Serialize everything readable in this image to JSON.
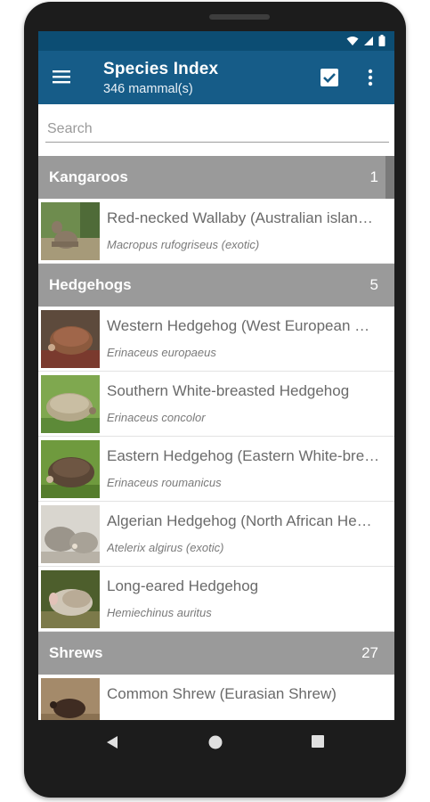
{
  "app": {
    "title": "Species Index",
    "subtitle": "346 mammal(s)",
    "menu_icon": "hamburger-menu-icon",
    "select_icon": "checkbox-icon",
    "more_icon": "more-vert-icon"
  },
  "colors": {
    "status_bar": "#0c4d73",
    "app_bar": "#165c88",
    "section_header": "#9a9a9a"
  },
  "search": {
    "placeholder": "Search"
  },
  "sections": [
    {
      "name": "Kangaroos",
      "count": "1",
      "items": [
        {
          "title": "Red-necked Wallaby (Australian islan…",
          "scientific": "Macropus rufogriseus (exotic)",
          "image": "wallaby-photo"
        }
      ]
    },
    {
      "name": "Hedgehogs",
      "count": "5",
      "items": [
        {
          "title": "Western Hedgehog (West European …",
          "scientific": "Erinaceus europaeus",
          "image": "hedgehog-photo"
        },
        {
          "title": "Southern White-breasted Hedgehog",
          "scientific": "Erinaceus concolor",
          "image": "hedgehog-photo"
        },
        {
          "title": "Eastern Hedgehog (Eastern White-bre…",
          "scientific": "Erinaceus roumanicus",
          "image": "hedgehog-photo"
        },
        {
          "title": "Algerian Hedgehog (North African He…",
          "scientific": "Atelerix algirus (exotic)",
          "image": "hedgehog-photo"
        },
        {
          "title": "Long-eared Hedgehog",
          "scientific": "Hemiechinus  auritus",
          "image": "hedgehog-photo"
        }
      ]
    },
    {
      "name": "Shrews",
      "count": "27",
      "items": [
        {
          "title": "Common Shrew (Eurasian Shrew)",
          "scientific": "",
          "image": "shrew-photo"
        }
      ]
    }
  ],
  "navigation": {
    "back_icon": "back-triangle-icon",
    "home_icon": "home-circle-icon",
    "recents_icon": "recents-square-icon"
  }
}
